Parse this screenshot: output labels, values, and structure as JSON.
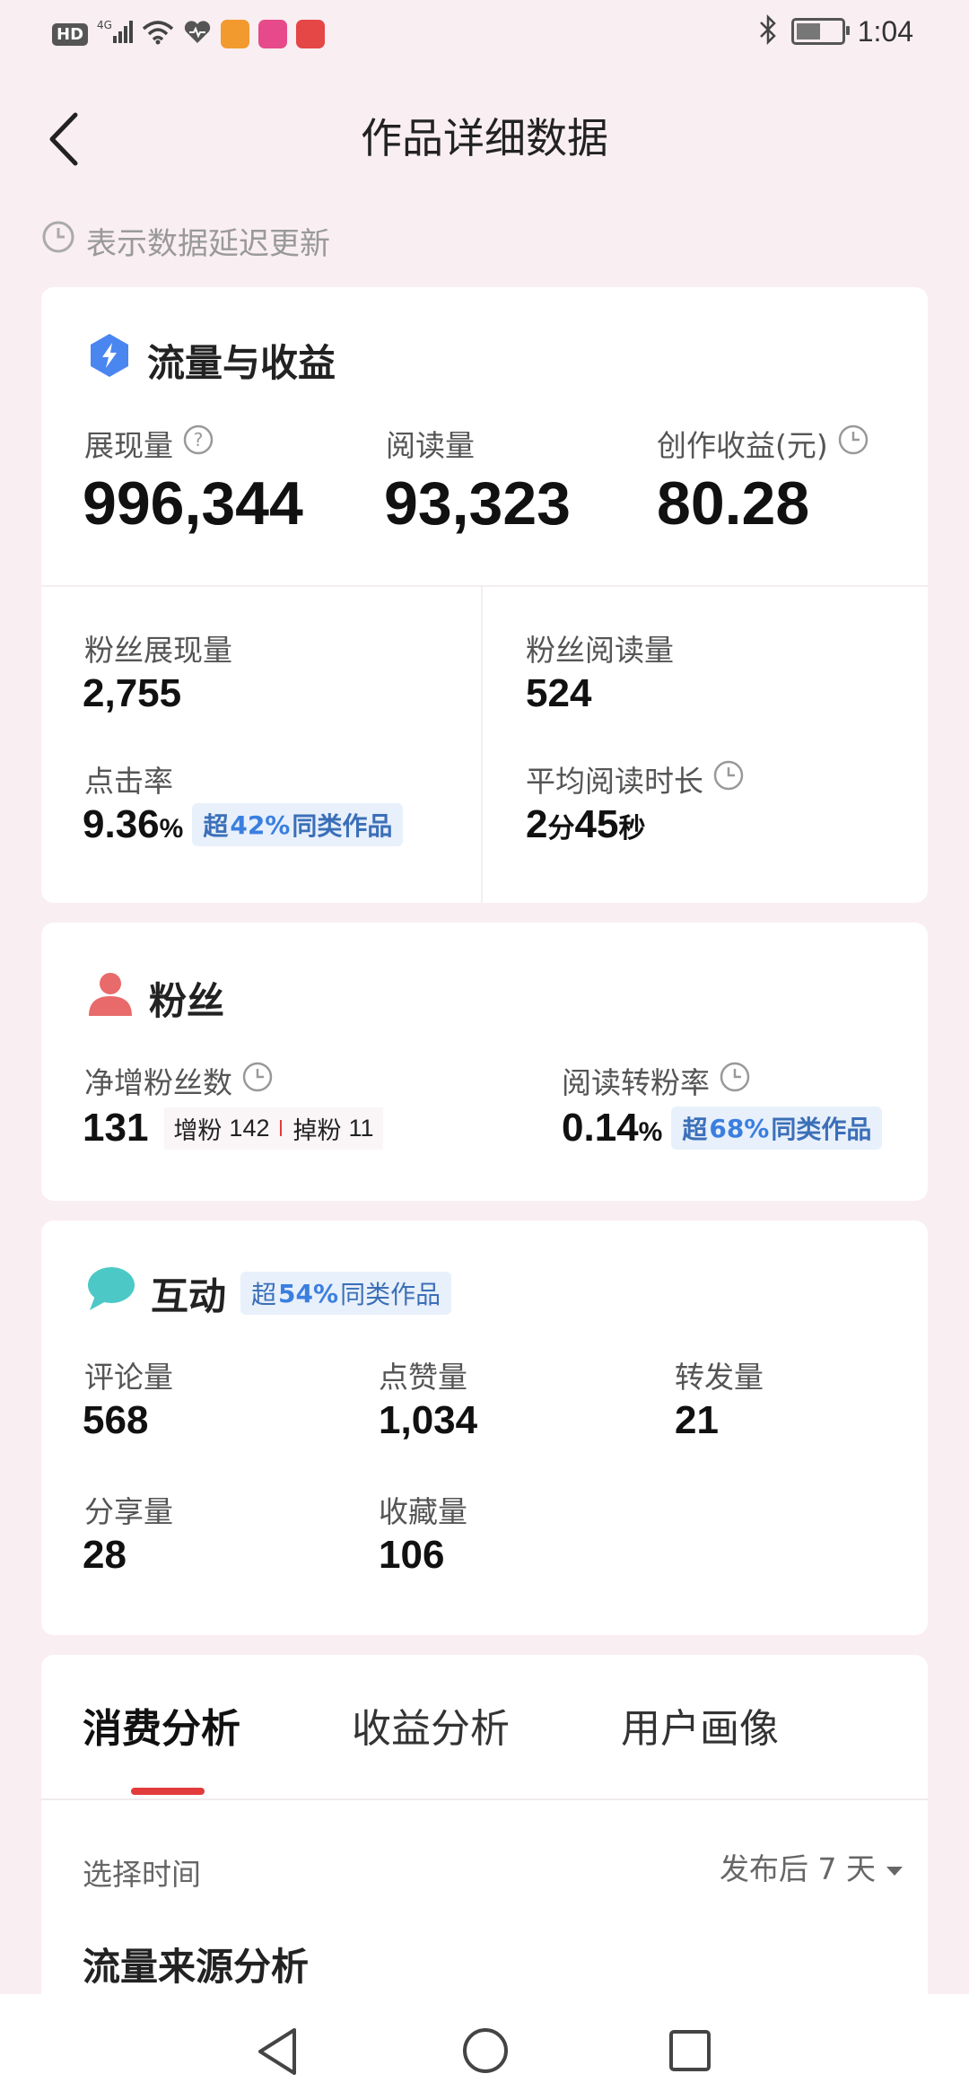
{
  "status_bar": {
    "network": "HD",
    "signal": "4G",
    "time": "1:04",
    "battery_level": 0.6
  },
  "header": {
    "title": "作品详细数据"
  },
  "note": {
    "text": "表示数据延迟更新"
  },
  "traffic": {
    "title": "流量与收益",
    "impressions_label": "展现量",
    "impressions": "996,344",
    "reads_label": "阅读量",
    "reads": "93,323",
    "earnings_label": "创作收益(元)",
    "earnings": "80.28",
    "fan_impressions_label": "粉丝展现量",
    "fan_impressions": "2,755",
    "fan_reads_label": "粉丝阅读量",
    "fan_reads": "524",
    "ctr_label": "点击率",
    "ctr_value": "9.36",
    "ctr_unit": "%",
    "ctr_badge_prefix": "超",
    "ctr_badge_pct": "42%",
    "ctr_badge_suffix": "同类作品",
    "avg_read_label": "平均阅读时长",
    "avg_read_min": "2",
    "avg_read_min_unit": "分",
    "avg_read_sec": "45",
    "avg_read_sec_unit": "秒"
  },
  "fans": {
    "title": "粉丝",
    "net_label": "净增粉丝数",
    "net_value": "131",
    "gain_label": "增粉",
    "gain_value": "142",
    "lost_label": "掉粉",
    "lost_value": "11",
    "conv_label": "阅读转粉率",
    "conv_value": "0.14",
    "conv_unit": "%",
    "conv_badge_prefix": "超",
    "conv_badge_pct": "68%",
    "conv_badge_suffix": "同类作品"
  },
  "interaction": {
    "title": "互动",
    "badge_prefix": "超",
    "badge_pct": "54%",
    "badge_suffix": "同类作品",
    "comments_label": "评论量",
    "comments": "568",
    "likes_label": "点赞量",
    "likes": "1,034",
    "reposts_label": "转发量",
    "reposts": "21",
    "shares_label": "分享量",
    "shares": "28",
    "favorites_label": "收藏量",
    "favorites": "106"
  },
  "analysis": {
    "tabs": [
      "消费分析",
      "收益分析",
      "用户画像"
    ],
    "time_label": "选择时间",
    "time_value": "发布后 7 天",
    "section_title": "流量来源分析"
  },
  "colors": {
    "background": "#f9eef1",
    "accent_red": "#e23b3b",
    "badge_blue": "#3a7fe0",
    "lightning_blue": "#4a86f0",
    "fan_red": "#e86a6a",
    "chat_teal": "#4cc9c6"
  }
}
